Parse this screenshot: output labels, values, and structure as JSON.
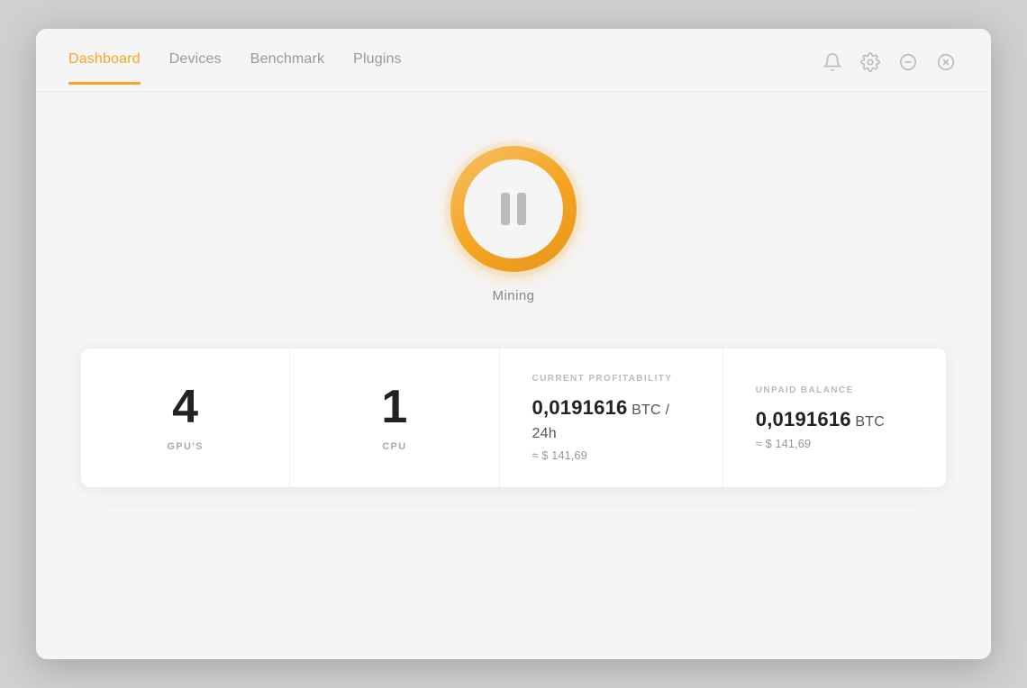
{
  "nav": {
    "items": [
      {
        "id": "dashboard",
        "label": "Dashboard",
        "active": true
      },
      {
        "id": "devices",
        "label": "Devices",
        "active": false
      },
      {
        "id": "benchmark",
        "label": "Benchmark",
        "active": false
      },
      {
        "id": "plugins",
        "label": "Plugins",
        "active": false
      }
    ]
  },
  "icons": {
    "bell": "bell-icon",
    "settings": "settings-icon",
    "minimize": "minimize-icon",
    "close": "close-icon"
  },
  "mining": {
    "button_label": "Mining",
    "state": "paused"
  },
  "stats": {
    "gpus": {
      "value": "4",
      "label": "GPU'S"
    },
    "cpu": {
      "value": "1",
      "label": "CPU"
    },
    "profitability": {
      "section_label": "CURRENT PROFITABILITY",
      "btc_value": "0,0191616",
      "btc_unit": " BTC / 24h",
      "usd_approx": "≈ $ 141,69"
    },
    "balance": {
      "section_label": "UNPAID BALANCE",
      "btc_value": "0,0191616",
      "btc_unit": " BTC",
      "usd_approx": "≈ $ 141,69"
    }
  },
  "colors": {
    "accent": "#f5a623",
    "nav_active": "#f5a623",
    "text_primary": "#222",
    "text_muted": "#999",
    "text_label": "#aaa"
  }
}
